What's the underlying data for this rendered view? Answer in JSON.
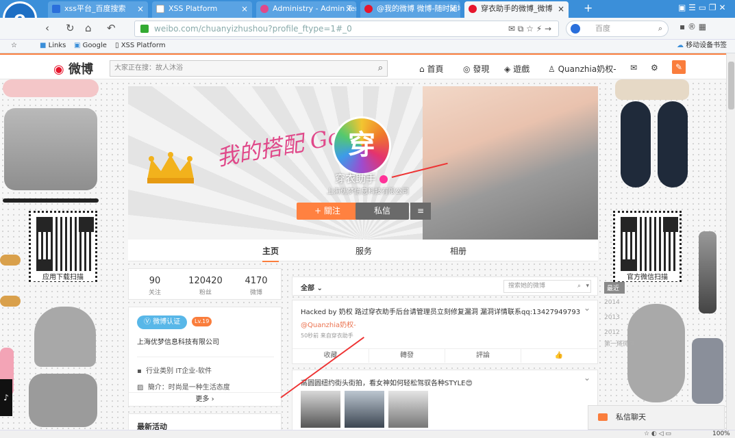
{
  "browser": {
    "tabs": [
      {
        "label": "xss平台_百度搜索",
        "icon_color": "#2a6fdb"
      },
      {
        "label": "XSS Platform",
        "icon_color": "#ffffff"
      },
      {
        "label": "Administry - Admin Tem",
        "icon_color": "#e0498a"
      },
      {
        "label": "@我的微博 微博-随时随地",
        "icon_color": "#e6162d"
      },
      {
        "label": "穿衣助手的微博_微博",
        "icon_color": "#e6162d"
      }
    ],
    "new_tab": "+",
    "url": "weibo.com/chuanyizhushou?profile_ftype=1#_0",
    "search_placeholder": "百度",
    "bookmarks": [
      "Links",
      "Google",
      "XSS Platform"
    ],
    "mobile_bookmarks": "移动设备书签",
    "zoom": "100%"
  },
  "weibo": {
    "logo_text": "微博",
    "search_placeholder": "大家正在搜：故人沐浴",
    "nav": [
      "首頁",
      "發現",
      "遊戲",
      "Quanzhia奶权-"
    ],
    "profile": {
      "cursive": "我的搭配 Go",
      "avatar_char": "穿",
      "name": "穿衣助手",
      "company": "上海优梦信息科技有限公司",
      "follow": "+ 關注",
      "message": "私信",
      "menu": "≡"
    },
    "tabs": [
      "主页",
      "服务",
      "相册"
    ],
    "stats": [
      {
        "value": "90",
        "label": "关注"
      },
      {
        "value": "120420",
        "label": "粉丝"
      },
      {
        "value": "4170",
        "label": "微博"
      }
    ],
    "verify_badge": "微博认证",
    "level": "Lv.19",
    "company": "上海优梦信息科技有限公司",
    "industry": "行业类别  IT企业-软件",
    "intro": "簡介：时尚是一种生活态度",
    "more": "更多 ›",
    "recent": "最新活动",
    "feed_filter": "全部",
    "feed_search_placeholder": "搜索她的微博",
    "posts": [
      {
        "text": "Hacked by 奶权 路过穿衣助手后台请管理员立刻修复漏洞 漏洞详情联系qq:13427949793",
        "mention": "@Quanzhia奶权-",
        "meta": "50秒前 来自穿衣助手",
        "actions": [
          "收藏",
          "轉發",
          "評論",
          "👍"
        ]
      },
      {
        "text": "高圆圆纽约街头街拍，看女神如何轻松驾驭各种STYLE😍"
      }
    ],
    "qr_left": "应用下载扫描",
    "qr_right": "官方微信扫描",
    "timeline": [
      "最近",
      "2014",
      "2013",
      "2012",
      "第一條微博"
    ],
    "chat": "私信聊天"
  }
}
